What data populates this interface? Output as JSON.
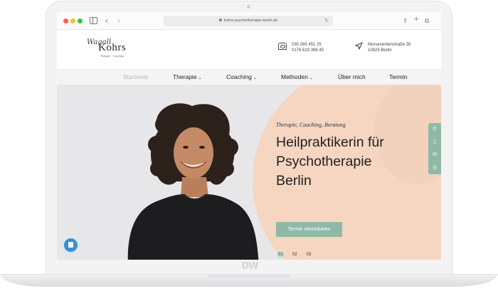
{
  "browser": {
    "url": "kohrs-psychotherapie-berlin.de",
    "back_icon": "chevron-left-icon",
    "forward_icon": "chevron-right-icon"
  },
  "site": {
    "logo": {
      "script": "Wagall",
      "name": "Kohrs",
      "subtitle": "Therapie · Coaching"
    },
    "contact": {
      "phone_1": "030 265 451 25",
      "phone_2": "0176 619 396 45",
      "street": "Monumentenstraße 35",
      "city": "10829 Berlin"
    },
    "menu": [
      {
        "label": "Startseite",
        "active": true
      },
      {
        "label": "Therapie",
        "dropdown": true
      },
      {
        "label": "Coaching",
        "dropdown": true
      },
      {
        "label": "Methoden",
        "dropdown": true
      },
      {
        "label": "Über mich"
      },
      {
        "label": "Termin"
      }
    ]
  },
  "hero": {
    "tagline": "Therapie, Coaching, Beratung",
    "headline_1": "Heilpraktikerin für",
    "headline_2": "Psychotherapie",
    "headline_3": "Berlin",
    "cta_label": "Termin vereinbaren",
    "slides": [
      "01",
      "02",
      "03"
    ],
    "active_slide": "01",
    "side_tools": [
      "phone-icon",
      "mobile-icon",
      "mail-icon",
      "clock-icon"
    ],
    "chat_icon": "chat-icon"
  },
  "colors": {
    "accent": "#8fb8a7",
    "peach": "#f6d6c1",
    "chat": "#3f8ed1"
  },
  "watermark": "DW"
}
